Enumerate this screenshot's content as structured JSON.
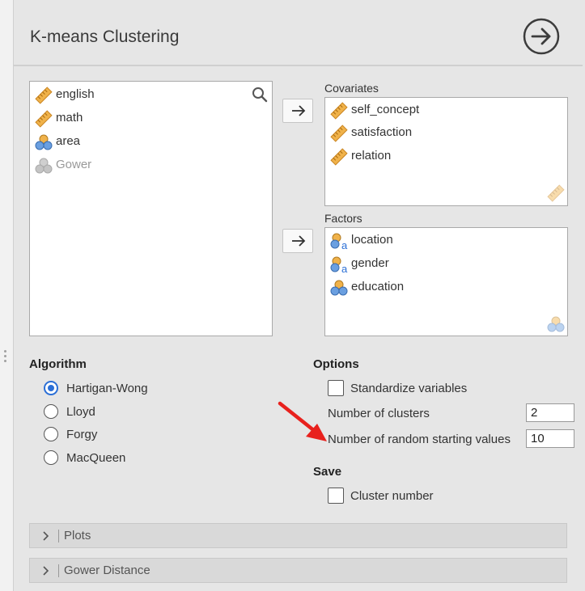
{
  "header": {
    "title": "K-means Clustering",
    "run_icon": "arrow-circle-right-icon"
  },
  "source": {
    "icon": "search-icon",
    "items": [
      {
        "label": "english",
        "type": "scale"
      },
      {
        "label": "math",
        "type": "scale"
      },
      {
        "label": "area",
        "type": "nominal"
      },
      {
        "label": "Gower",
        "type": "nominal-disabled"
      }
    ]
  },
  "covariates": {
    "label": "Covariates",
    "items": [
      {
        "label": "self_concept",
        "type": "scale"
      },
      {
        "label": "satisfaction",
        "type": "scale"
      },
      {
        "label": "relation",
        "type": "scale"
      }
    ]
  },
  "factors": {
    "label": "Factors",
    "items": [
      {
        "label": "location",
        "type": "nominal-text"
      },
      {
        "label": "gender",
        "type": "nominal-text"
      },
      {
        "label": "education",
        "type": "nominal"
      }
    ]
  },
  "algorithm": {
    "label": "Algorithm",
    "options": [
      {
        "label": "Hartigan-Wong",
        "selected": true
      },
      {
        "label": "Lloyd",
        "selected": false
      },
      {
        "label": "Forgy",
        "selected": false
      },
      {
        "label": "MacQueen",
        "selected": false
      }
    ]
  },
  "options": {
    "label": "Options",
    "standardize_label": "Standardize variables",
    "clusters_label": "Number of clusters",
    "clusters_value": "2",
    "random_label": "Number of random starting values",
    "random_value": "10"
  },
  "save": {
    "label": "Save",
    "cluster_number_label": "Cluster number"
  },
  "panels": [
    {
      "label": "Plots"
    },
    {
      "label": "Gower Distance"
    }
  ],
  "colors": {
    "accent": "#2b6fd6",
    "annotation_arrow": "#e8211d",
    "scale_icon": "#e8a43a"
  }
}
